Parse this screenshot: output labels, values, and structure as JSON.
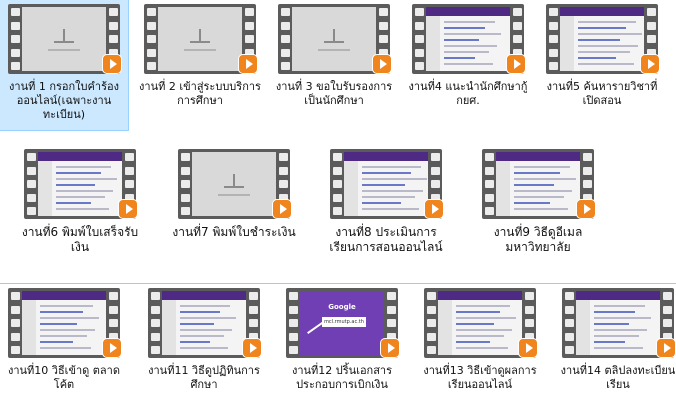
{
  "items": [
    {
      "label": "งานที่ 1 กรอกใบคำร้องออนไลน์(เฉพาะงานทะเบียน)",
      "thumb": "blank-screen",
      "selected": true
    },
    {
      "label": "งานที่ 2 เข้าสู่ระบบบริการการศึกษา",
      "thumb": "blank-screen",
      "selected": false
    },
    {
      "label": "งานที่ 3 ขอใบรับรองการเป็นนักศึกษา",
      "thumb": "blank-screen",
      "selected": false
    },
    {
      "label": "งานที่4 แนะนำนักศึกษากู้ กยศ.",
      "thumb": "web-page",
      "selected": false
    },
    {
      "label": "งานที่5 ค้นหารายวิชาที่เปิดสอน",
      "thumb": "web-page",
      "selected": false
    },
    {
      "label": "งานที่6 พิมพ์ใบเสร็จรับเงิน",
      "thumb": "web-page",
      "selected": false
    },
    {
      "label": "งานที่7 พิมพ์ใบชำระเงิน",
      "thumb": "blank-screen",
      "selected": false
    },
    {
      "label": "งานที่8 ประเมินการเรียนการสอนออนไลน์",
      "thumb": "web-page",
      "selected": false
    },
    {
      "label": "งานที่9 วิธีดูอีเมลมหาวิทยาลัย",
      "thumb": "web-page",
      "selected": false
    },
    {
      "label": "งานที่10 วิธีเข้าดู ตลาดโค้ต",
      "thumb": "web-page",
      "selected": false
    },
    {
      "label": "งานที่11 วิธีดูปฏิทินการศึกษา",
      "thumb": "web-page",
      "selected": false
    },
    {
      "label": "งานที่12 ปริ้นเอกสารประกอบการเบิกเงิน",
      "thumb": "google-login",
      "selected": false
    },
    {
      "label": "งานที่13 วิธีเข้าดูผลการเรียนออนไลน์",
      "thumb": "web-page",
      "selected": false
    },
    {
      "label": "งานที่14 ตลิปลงทะเบียนเรียน",
      "thumb": "web-page",
      "selected": false
    }
  ],
  "google_thumb": {
    "brand": "Google",
    "email": "mcl.rmutp.ac.th"
  },
  "icons": {
    "file": "video-file-icon",
    "overlay": "play-icon"
  },
  "colors": {
    "play": "#f0851e",
    "selection": "#cce8ff",
    "film": "#5b5b5b",
    "web_header": "#4e2a84"
  }
}
